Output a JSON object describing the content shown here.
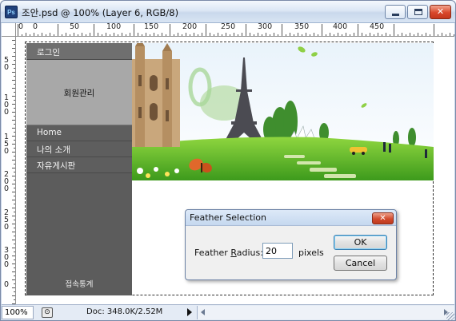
{
  "window": {
    "app_icon": "Ps",
    "title": "조안.psd @ 100% (Layer 6, RGB/8)",
    "minimize_icon": "minimize-icon",
    "maximize_icon": "maximize-icon",
    "close_icon": "close-icon",
    "close_glyph": "✕"
  },
  "rulers": {
    "horizontal": [
      "0",
      "50",
      "100",
      "150",
      "200",
      "250",
      "300",
      "350",
      "400",
      "450"
    ],
    "horizontal_extra": "0",
    "vertical": [
      "50",
      "100",
      "150",
      "200",
      "250",
      "300",
      "0"
    ]
  },
  "page": {
    "nav": {
      "login": "로그인",
      "member_box": "회원관리",
      "items": [
        "Home",
        "나의 소개",
        "자유게시판"
      ],
      "footer": "접속통계"
    },
    "colors": {
      "nav_bg": "#5c5c5c",
      "member_box_bg": "#a8a8a8",
      "sky": "#e4f2fb",
      "grass": "#5fbf2a"
    }
  },
  "dialog": {
    "title": "Feather Selection",
    "close_glyph": "✕",
    "radius_label_prefix": "Feather ",
    "radius_label_underlined": "R",
    "radius_label_suffix": "adius:",
    "radius_value": "20",
    "unit": "pixels",
    "ok_label": "OK",
    "cancel_label": "Cancel"
  },
  "statusbar": {
    "zoom": "100%",
    "doc_info": "Doc: 348.0K/2.52M"
  }
}
